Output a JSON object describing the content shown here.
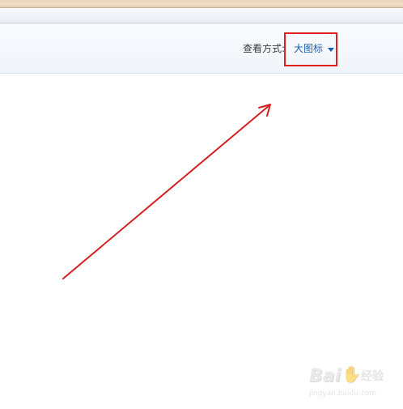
{
  "toolbar": {
    "view_mode_label": "查看方式:",
    "view_mode_value": "大图标"
  },
  "watermark": {
    "logo": "Bai",
    "logo_suffix": "经验",
    "url": "jingyan.baidu.com"
  },
  "colors": {
    "highlight_box": "#e02020",
    "arrow": "#d42020",
    "link_blue": "#1a5fb4"
  },
  "icons": {
    "dropdown": "caret-down-icon",
    "annotation": "arrow-icon",
    "watermark_paw": "paw-icon"
  }
}
